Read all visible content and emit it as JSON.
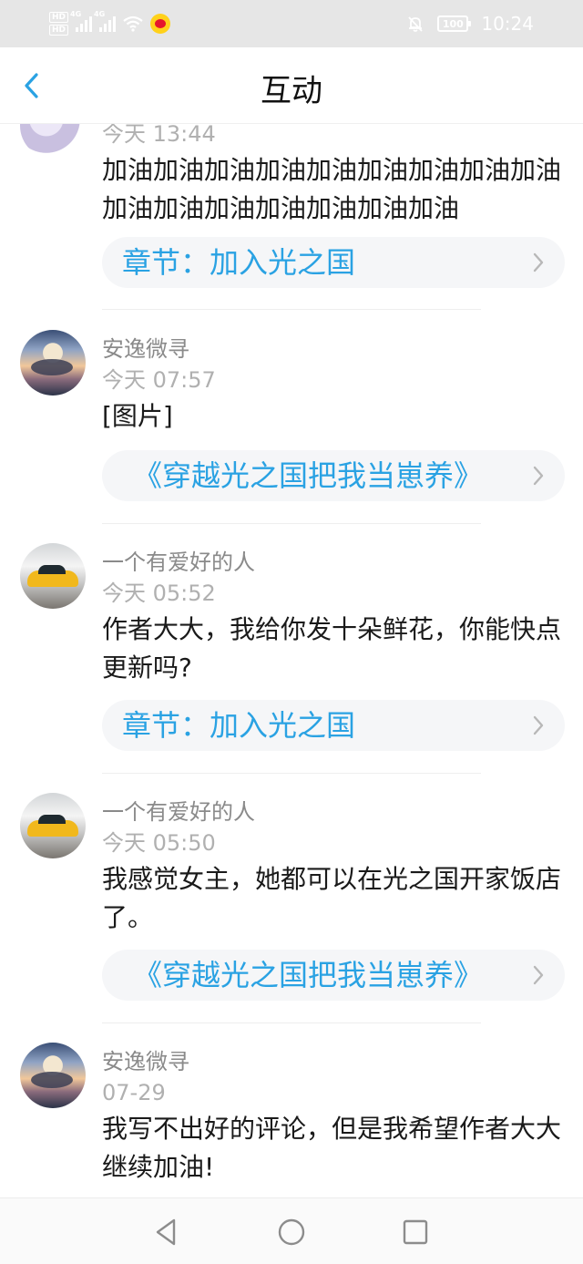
{
  "status_bar": {
    "hd_labels": [
      "HD",
      "HD"
    ],
    "network_1": "4G",
    "network_2": "4G",
    "battery": "100",
    "time": "10:24"
  },
  "header": {
    "title": "互动"
  },
  "comments": [
    {
      "name": "",
      "time": "今天 13:44",
      "text": "加油加油加油加油加油加油加油加油加油加油加油加油加油加油加油加油",
      "card": "章节：加入光之国"
    },
    {
      "name": "安逸微寻",
      "time": "今天 07:57",
      "text": "[图片]",
      "card": "《穿越光之国把我当崽养》"
    },
    {
      "name": "一个有爱好的人",
      "time": "今天 05:52",
      "text": "作者大大，我给你发十朵鲜花，你能快点更新吗?",
      "card": "章节：加入光之国"
    },
    {
      "name": "一个有爱好的人",
      "time": "今天 05:50",
      "text": "我感觉女主，她都可以在光之国开家饭店了。",
      "card": "《穿越光之国把我当崽养》"
    },
    {
      "name": "安逸微寻",
      "time": "07-29",
      "text": "我写不出好的评论，但是我希望作者大大继续加油!",
      "card": ""
    }
  ],
  "icons": {
    "back": "chevron-left-icon",
    "card_arrow": "chevron-right-icon",
    "nav": [
      "back-triangle-icon",
      "home-circle-icon",
      "recents-square-icon"
    ]
  },
  "colors": {
    "accent": "#2aa2e3",
    "card_bg": "#f5f6f8",
    "status_bar": "#e6e6e6"
  }
}
